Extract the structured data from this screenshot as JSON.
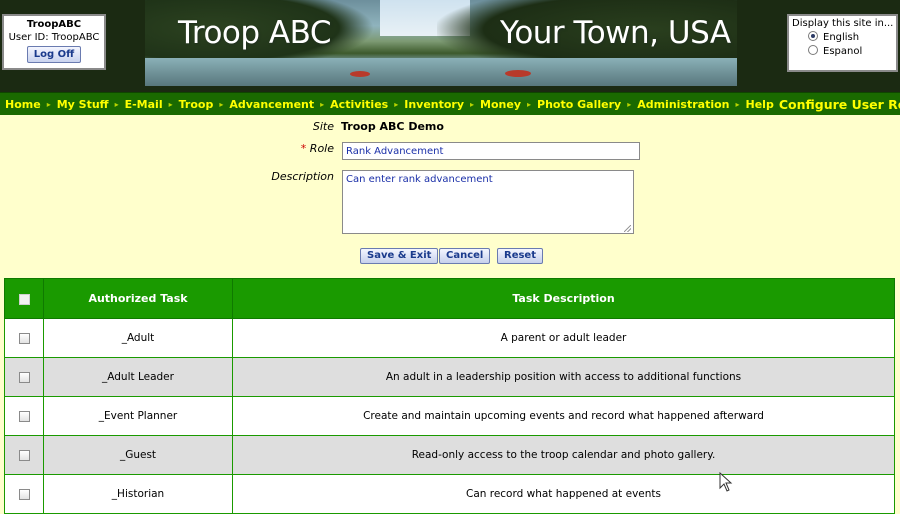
{
  "header": {
    "user": {
      "name": "TroopABC",
      "user_id_label": "User ID:",
      "user_id": "TroopABC",
      "logoff_label": "Log Off"
    },
    "banner": {
      "title_left": "Troop ABC",
      "title_right": "Your Town, USA"
    },
    "language": {
      "label": "Display this site in...",
      "options": [
        "English",
        "Espanol"
      ],
      "selected": "English"
    }
  },
  "nav": {
    "items": [
      "Home",
      "My Stuff",
      "E-Mail",
      "Troop",
      "Advancement",
      "Activities",
      "Inventory",
      "Money",
      "Photo Gallery",
      "Administration",
      "Help"
    ],
    "current": "Configure User Roles"
  },
  "form": {
    "site_label": "Site",
    "site_value": "Troop ABC Demo",
    "role_required_mark": "*",
    "role_label": "Role",
    "role_value": "Rank Advancement",
    "description_label": "Description",
    "description_value": "Can enter rank advancement",
    "buttons": {
      "save_exit": "Save & Exit",
      "cancel": "Cancel",
      "reset": "Reset"
    }
  },
  "table": {
    "columns": [
      "Authorized Task",
      "Task Description"
    ],
    "rows": [
      {
        "task": "_Adult",
        "description": "A parent or adult leader",
        "checked": false
      },
      {
        "task": "_Adult Leader",
        "description": "An adult in a leadership position with access to additional functions",
        "checked": false
      },
      {
        "task": "_Event Planner",
        "description": "Create and maintain upcoming events and record what happened afterward",
        "checked": false
      },
      {
        "task": "_Guest",
        "description": "Read-only access to the troop calendar and photo gallery.",
        "checked": false
      },
      {
        "task": "_Historian",
        "description": "Can record what happened at events",
        "checked": false
      }
    ]
  },
  "colors": {
    "page_bg": "#ffffcc",
    "nav_bg": "#1a6a00",
    "nav_text": "#ffff00",
    "table_header": "#1a9a00",
    "row_alt": "#dedede"
  }
}
